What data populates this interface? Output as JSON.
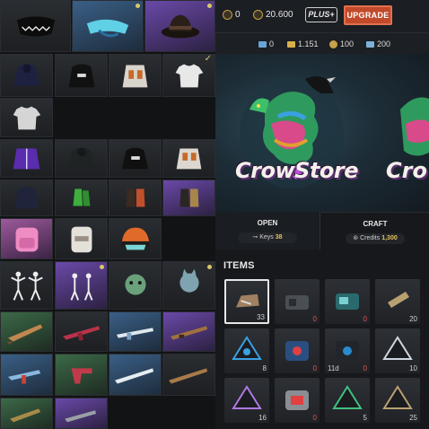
{
  "currencies": {
    "g_coins": "0",
    "bp": "20.600",
    "plus_label": "PLUS+",
    "upgrade_label": "UPGRADE"
  },
  "secondary": {
    "silver": "0",
    "gold": "1.151",
    "crowns": "100",
    "planes": "200"
  },
  "banner": {
    "title_a": "CrowStore",
    "title_b": "Crow"
  },
  "tabs": {
    "open": {
      "label": "OPEN",
      "pill_prefix": "Keys",
      "pill_value": "38"
    },
    "craft": {
      "label": "CRAFT",
      "pill_prefix": "Credits",
      "pill_value": "1,300"
    }
  },
  "items_header": "ITEMS",
  "items": [
    {
      "qty": "33",
      "qty_color": "white"
    },
    {
      "qty": "0",
      "qty_color": "red"
    },
    {
      "qty": "0",
      "qty_color": "red"
    },
    {
      "qty": "20",
      "qty_color": "white"
    },
    {
      "qty": "8",
      "qty_color": "white"
    },
    {
      "qty": "0",
      "qty_color": "red"
    },
    {
      "qty": "0",
      "qty_color": "red",
      "timer": "11d"
    },
    {
      "qty": "10",
      "qty_color": "white"
    },
    {
      "qty": "16",
      "qty_color": "white"
    },
    {
      "qty": "0",
      "qty_color": "red"
    },
    {
      "qty": "5",
      "qty_color": "white"
    },
    {
      "qty": "25",
      "qty_color": "white"
    }
  ],
  "colors": {
    "accent_upgrade": "#c24a2a",
    "gold_text": "#e3c15a",
    "zero_qty": "#e05050",
    "rarity_blue": "#3a5f86",
    "rarity_purple": "#6a49a8",
    "rarity_pink": "#9d5a9b",
    "rarity_green": "#3c6a48"
  }
}
